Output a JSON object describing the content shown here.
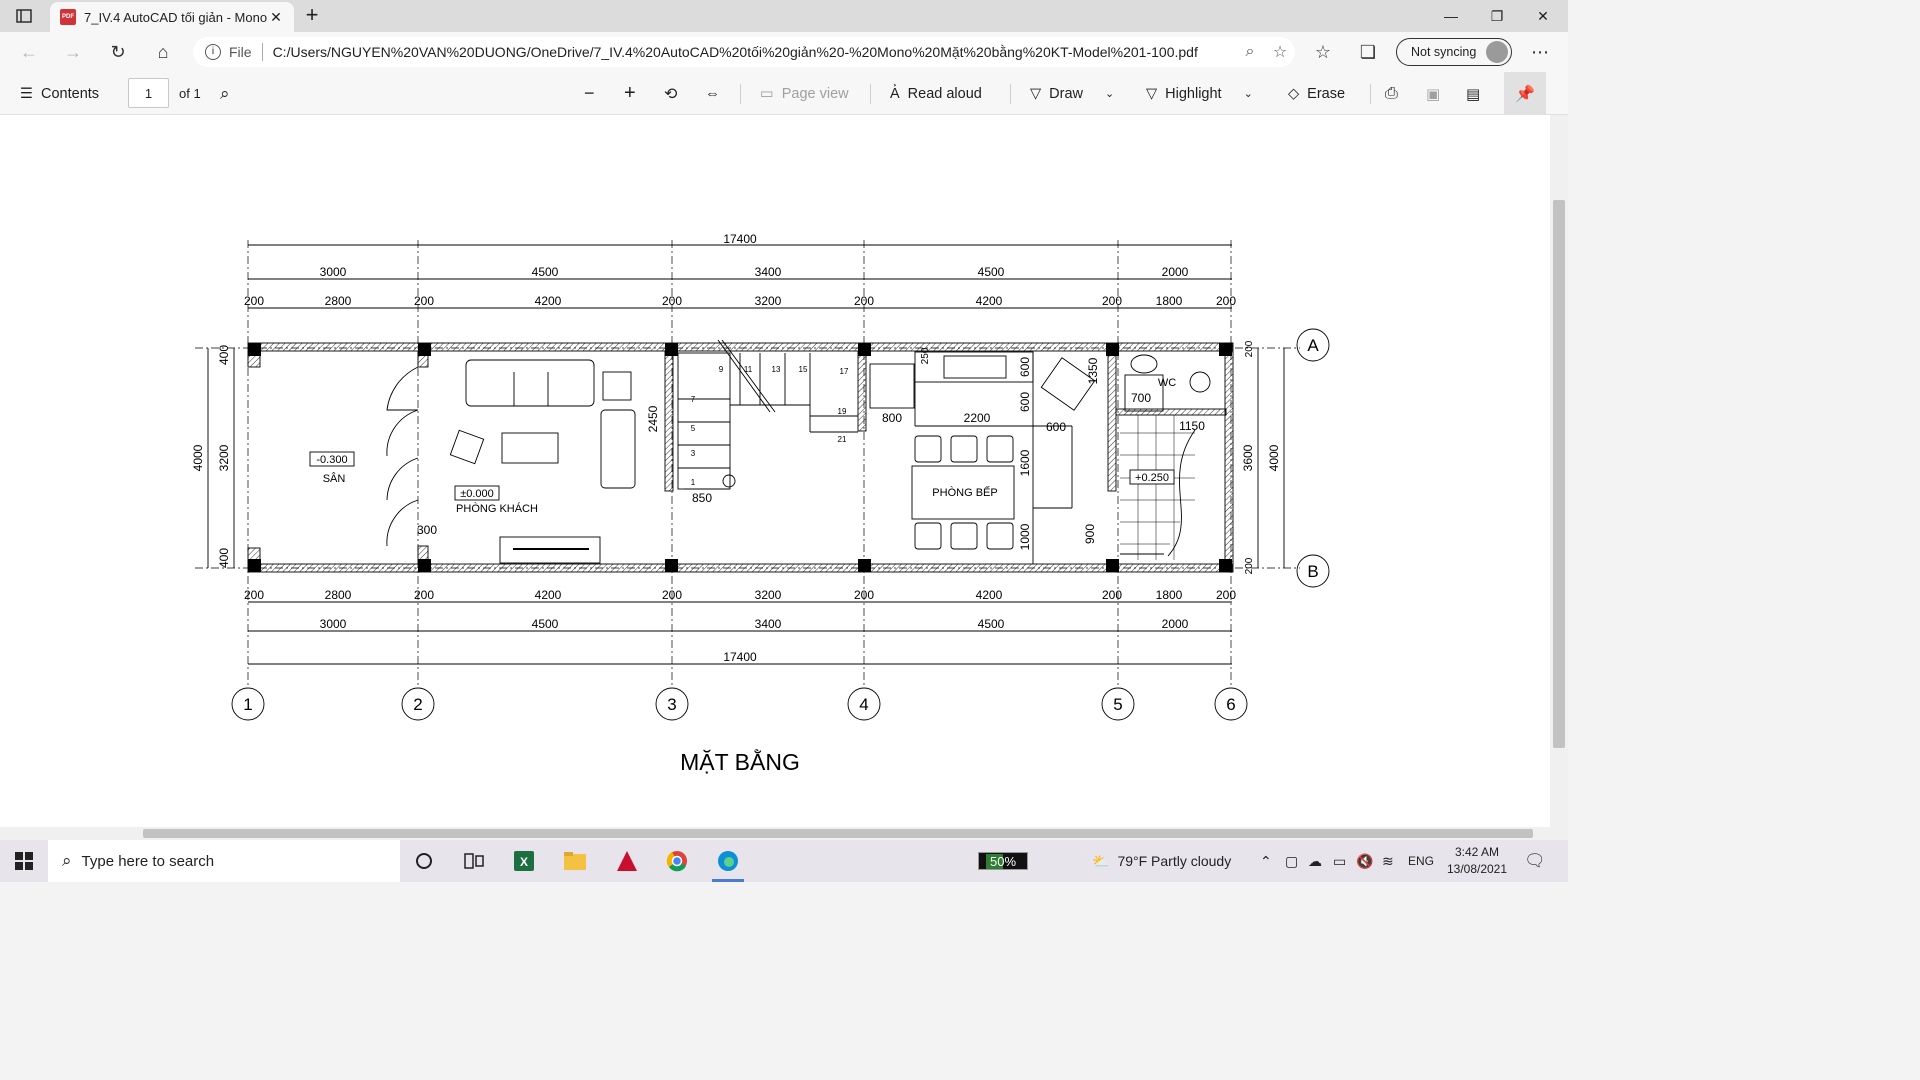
{
  "browser": {
    "tab_title": "7_IV.4 AutoCAD tối giản - Mono",
    "tab_icon": "PDF",
    "address_prefix": "File",
    "url": "C:/Users/NGUYEN%20VAN%20DUONG/OneDrive/7_IV.4%20AutoCAD%20tối%20giản%20-%20Mono%20Mặt%20bằng%20KT-Model%201-100.pdf",
    "sync_label": "Not syncing"
  },
  "pdf_toolbar": {
    "contents_label": "Contents",
    "page_number": "1",
    "page_total": "of 1",
    "page_view_label": "Page view",
    "read_aloud_label": "Read aloud",
    "draw_label": "Draw",
    "highlight_label": "Highlight",
    "erase_label": "Erase"
  },
  "drawing": {
    "title": "MẶT BẰNG",
    "overall_dim": "17400",
    "axis_dims": [
      "3000",
      "4500",
      "3400",
      "4500",
      "2000"
    ],
    "clear_dims": [
      "200",
      "2800",
      "200",
      "4200",
      "200",
      "3200",
      "200",
      "4200",
      "200",
      "1800",
      "200"
    ],
    "column_axes": [
      "1",
      "2",
      "3",
      "4",
      "5",
      "6"
    ],
    "row_axes": [
      "A",
      "B"
    ],
    "left_dims": [
      "400",
      "3200",
      "400",
      "4000"
    ],
    "right_dims": [
      "200",
      "3600",
      "200",
      "4000"
    ],
    "rooms": {
      "yard": "SÂN",
      "yard_level": "-0.300",
      "living": "PHÒNG KHÁCH",
      "living_level": "±0.000",
      "kitchen": "PHÒNG BẾP",
      "wc": "WC",
      "wc_level": "+0.250"
    },
    "inner_dims": {
      "door_300": "300",
      "stair_2450": "2450",
      "stair_850": "850",
      "d800": "800",
      "d2200": "2200",
      "d600a": "600",
      "d600b": "600",
      "d600c": "600",
      "d1600": "1600",
      "d1000": "1000",
      "d1350": "1350",
      "d700": "700",
      "d1150": "1150",
      "d900": "900",
      "d250": "250"
    },
    "stair_numbers": [
      "1",
      "3",
      "5",
      "7",
      "9",
      "11",
      "13",
      "15",
      "17",
      "19",
      "21"
    ]
  },
  "taskbar": {
    "search_placeholder": "Type here to search",
    "battery": "50%",
    "weather": "79°F  Partly cloudy",
    "lang": "ENG",
    "time": "3:42 AM",
    "date": "13/08/2021"
  }
}
